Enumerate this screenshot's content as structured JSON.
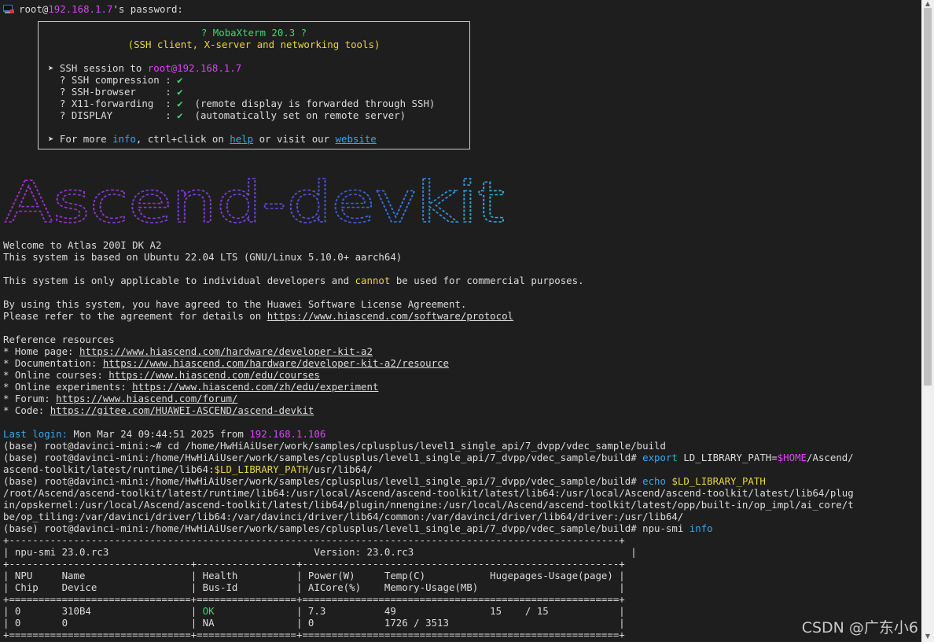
{
  "prompt": {
    "user_host": "root@",
    "ip": "192.168.1.7",
    "suffix": "'s password:"
  },
  "banner": {
    "title": "? MobaXterm 20.3 ?",
    "subtitle": "(SSH client, X-server and networking tools)",
    "session_prefix": "➤ SSH session to ",
    "session_user": "root",
    "session_ip": "@192.168.1.7",
    "features": [
      {
        "label": "  ? SSH compression : ",
        "check": "✔",
        "note": ""
      },
      {
        "label": "  ? SSH-browser     : ",
        "check": "✔",
        "note": ""
      },
      {
        "label": "  ? X11-forwarding  : ",
        "check": "✔",
        "note": "  (remote display is forwarded through SSH)"
      },
      {
        "label": "  ? DISPLAY         : ",
        "check": "✔",
        "note": "  (automatically set on remote server)"
      }
    ],
    "more_prefix": "➤ For more ",
    "more_info": "info",
    "more_mid": ", ctrl+click on ",
    "more_help": "help",
    "more_mid2": " or visit our ",
    "more_website": "website"
  },
  "logo_text": "Ascend-devkit",
  "welcome": {
    "line1": "Welcome to Atlas 200I DK A2",
    "line2": "This system is based on Ubuntu 22.04 LTS (GNU/Linux 5.10.0+ aarch64)",
    "line3_a": "This system is only applicable to individual developers and ",
    "line3_b": "cannot",
    "line3_c": " be used for commercial purposes.",
    "line4": "By using this system, you have agreed to the Huawei Software License Agreement.",
    "line5_a": "Please refer to the agreement for details on ",
    "line5_link": "https://www.hiascend.com/software/protocol"
  },
  "resources": {
    "heading": "Reference resources",
    "items": [
      {
        "label": "* Home page: ",
        "url": "https://www.hiascend.com/hardware/developer-kit-a2"
      },
      {
        "label": "* Documentation: ",
        "url": "https://www.hiascend.com/hardware/developer-kit-a2/resource"
      },
      {
        "label": "* Online courses: ",
        "url": "https://www.hiascend.com/edu/courses"
      },
      {
        "label": "* Online experiments: ",
        "url": "https://www.hiascend.com/zh/edu/experiment"
      },
      {
        "label": "* Forum: ",
        "url": "https://www.hiascend.com/forum/"
      },
      {
        "label": "* Code: ",
        "url": "https://gitee.com/HUAWEI-ASCEND/ascend-devkit"
      }
    ]
  },
  "session": {
    "last_login_label": "Last login:",
    "last_login_value": " Mon Mar 24 09:44:51 2025 from ",
    "last_login_ip": "192.168.1.106",
    "cmd1": "(base) root@davinci-mini:~# cd /home/HwHiAiUser/work/samples/cplusplus/level1_single_api/7_dvpp/vdec_sample/build",
    "cmd2_a": "(base) root@davinci-mini:/home/HwHiAiUser/work/samples/cplusplus/level1_single_api/7_dvpp/vdec_sample/build# ",
    "cmd2_export": "export",
    "cmd2_b": " LD_LIBRARY_PATH=",
    "cmd2_home": "$HOME",
    "cmd2_c": "/Ascend/",
    "cmd2_line2_a": "ascend-toolkit/latest/runtime/lib64:",
    "cmd2_line2_var": "$LD_LIBRARY_PATH",
    "cmd2_line2_b": "/usr/lib64/",
    "cmd3_a": "(base) root@davinci-mini:/home/HwHiAiUser/work/samples/cplusplus/level1_single_api/7_dvpp/vdec_sample/build# ",
    "cmd3_echo": "echo",
    "cmd3_var": " $LD_LIBRARY_PATH",
    "out1": "/root/Ascend/ascend-toolkit/latest/runtime/lib64:/usr/local/Ascend/ascend-toolkit/latest/lib64:/usr/local/Ascend/ascend-toolkit/latest/lib64/plug",
    "out2": "in/opskernel:/usr/local/Ascend/ascend-toolkit/latest/lib64/plugin/nnengine:/usr/local/Ascend/ascend-toolkit/latest/opp/built-in/op_impl/ai_core/t",
    "out3": "be/op_tiling:/var/davinci/driver/lib64:/var/davinci/driver/lib64/common:/var/davinci/driver/lib64/driver:/usr/lib64/",
    "cmd4_a": "(base) root@davinci-mini:/home/HwHiAiUser/work/samples/cplusplus/level1_single_api/7_dvpp/vdec_sample/build# npu-smi ",
    "cmd4_info": "info"
  },
  "npu_table": {
    "border_top": "+--------------------------------------------------------------------------------------------------------+",
    "row_header": "| npu-smi 23.0.rc3                                   Version: 23.0.rc3                                     |",
    "sep1": "+-------------------------------+-----------------+------------------------------------------------------+",
    "h1": "| NPU     Name                  | Health          | Power(W)     Temp(C)           Hugepages-Usage(page) |",
    "h2": "| Chip    Device                | Bus-Id          | AICore(%)    Memory-Usage(MB)                        |",
    "sep2": "+===============================+=================+======================================================+",
    "r1_a": "| 0       310B4                 | ",
    "r1_ok": "OK",
    "r1_b": "              | 7.3          49                15    / 15            |",
    "r2": "| 0       0                     | NA              | 0            1726 / 3513                             |",
    "sep3": "+===============================+=================+======================================================+"
  },
  "watermark": "CSDN @广东小6"
}
